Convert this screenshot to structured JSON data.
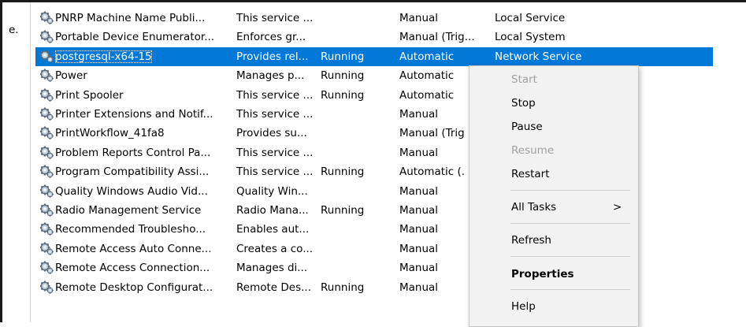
{
  "left_pane": {
    "text": "e."
  },
  "services": [
    {
      "name": "PNRP Machine Name Publi...",
      "description": "This service ...",
      "status": "",
      "startup": "Manual",
      "logon": "Local Service"
    },
    {
      "name": "Portable Device Enumerator...",
      "description": "Enforces gr...",
      "status": "",
      "startup": "Manual (Trig...",
      "logon": "Local System"
    },
    {
      "name": "postgresql-x64-15",
      "description": "Provides rel...",
      "status": "Running",
      "startup": "Automatic",
      "logon": "Network Service",
      "selected": true
    },
    {
      "name": "Power",
      "description": "Manages p...",
      "status": "Running",
      "startup": "Automatic",
      "logon": ""
    },
    {
      "name": "Print Spooler",
      "description": "This service ...",
      "status": "Running",
      "startup": "Automatic",
      "logon": ""
    },
    {
      "name": "Printer Extensions and Notif...",
      "description": "This service ...",
      "status": "",
      "startup": "Manual",
      "logon": ""
    },
    {
      "name": "PrintWorkflow_41fa8",
      "description": "Provides su...",
      "status": "",
      "startup": "Manual (Trig",
      "logon": ""
    },
    {
      "name": "Problem Reports Control Pa...",
      "description": "This service ...",
      "status": "",
      "startup": "Manual",
      "logon": ""
    },
    {
      "name": "Program Compatibility Assi...",
      "description": "This service ...",
      "status": "Running",
      "startup": "Automatic (.",
      "logon": ""
    },
    {
      "name": "Quality Windows Audio Vid...",
      "description": "Quality Win...",
      "status": "",
      "startup": "Manual",
      "logon": ""
    },
    {
      "name": "Radio Management Service",
      "description": "Radio Mana...",
      "status": "Running",
      "startup": "Manual",
      "logon": ""
    },
    {
      "name": "Recommended Troublesho...",
      "description": "Enables aut...",
      "status": "",
      "startup": "Manual",
      "logon": ""
    },
    {
      "name": "Remote Access Auto Conne...",
      "description": "Creates a co...",
      "status": "",
      "startup": "Manual",
      "logon": ""
    },
    {
      "name": "Remote Access Connection...",
      "description": "Manages di...",
      "status": "",
      "startup": "Manual",
      "logon": ""
    },
    {
      "name": "Remote Desktop Configurat...",
      "description": "Remote Des...",
      "status": "Running",
      "startup": "Manual",
      "logon": ""
    }
  ],
  "context_menu": {
    "items": [
      {
        "label": "Start",
        "disabled": true
      },
      {
        "label": "Stop"
      },
      {
        "label": "Pause"
      },
      {
        "label": "Resume",
        "disabled": true
      },
      {
        "label": "Restart"
      },
      {
        "label": "All Tasks",
        "submenu": true
      },
      {
        "label": "Refresh"
      },
      {
        "label": "Properties",
        "bold": true
      },
      {
        "label": "Help"
      }
    ],
    "submenu_arrow": ">"
  },
  "colors": {
    "selection": "#0078d7",
    "menu_bg": "#f2f2f2",
    "disabled_text": "#a0a0a0"
  },
  "icons": {
    "service": "gear-icon"
  }
}
